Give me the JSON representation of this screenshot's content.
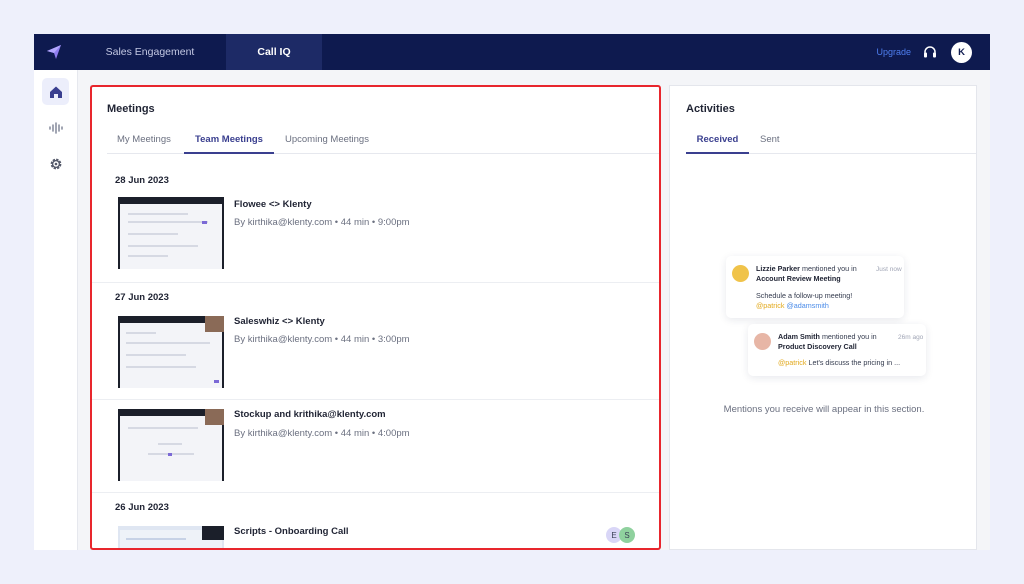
{
  "nav": {
    "tabs": [
      "Sales Engagement",
      "Call IQ"
    ],
    "upgrade": "Upgrade",
    "avatar_initial": "K"
  },
  "sidebar": {
    "items": [
      "home-icon",
      "waveform-icon",
      "gear-icon"
    ]
  },
  "meetings": {
    "title": "Meetings",
    "tabs": [
      "My Meetings",
      "Team Meetings",
      "Upcoming Meetings"
    ],
    "active_tab": "Team Meetings",
    "groups": [
      {
        "date": "28 Jun 2023",
        "items": [
          {
            "title": "Flowee <> Klenty",
            "meta": "By kirthika@klenty.com • 44 min • 9:00pm"
          }
        ]
      },
      {
        "date": "27 Jun 2023",
        "items": [
          {
            "title": "Saleswhiz <> Klenty",
            "meta": "By kirthika@klenty.com • 44 min • 3:00pm"
          },
          {
            "title": "Stockup and krithika@klenty.com",
            "meta": "By kirthika@klenty.com • 44 min • 4:00pm"
          }
        ]
      },
      {
        "date": "26 Jun 2023",
        "items": [
          {
            "title": "Scripts - Onboarding Call",
            "participants": [
              "E",
              "S"
            ]
          }
        ]
      }
    ]
  },
  "activities": {
    "title": "Activities",
    "tabs": [
      "Received",
      "Sent"
    ],
    "active_tab": "Received",
    "notifications": [
      {
        "name": "Lizzie Parker",
        "action": "mentioned you in",
        "meeting": "Account Review Meeting",
        "time": "Just now",
        "message": "Schedule a follow-up meeting!",
        "mentions": [
          "@patrick",
          "@adamsmith"
        ]
      },
      {
        "name": "Adam Smith",
        "action": "mentioned you in",
        "meeting": "Product Discovery Call",
        "time": "26m ago",
        "mention": "@patrick",
        "message": "Let's discuss the pricing in ..."
      }
    ],
    "empty_message": "Mentions you receive will appear in this section."
  },
  "colors": {
    "nav_bg": "#0e1a4f",
    "accent": "#3a3f8f",
    "highlight": "#e8262d",
    "upgrade": "#4f7ff0"
  }
}
